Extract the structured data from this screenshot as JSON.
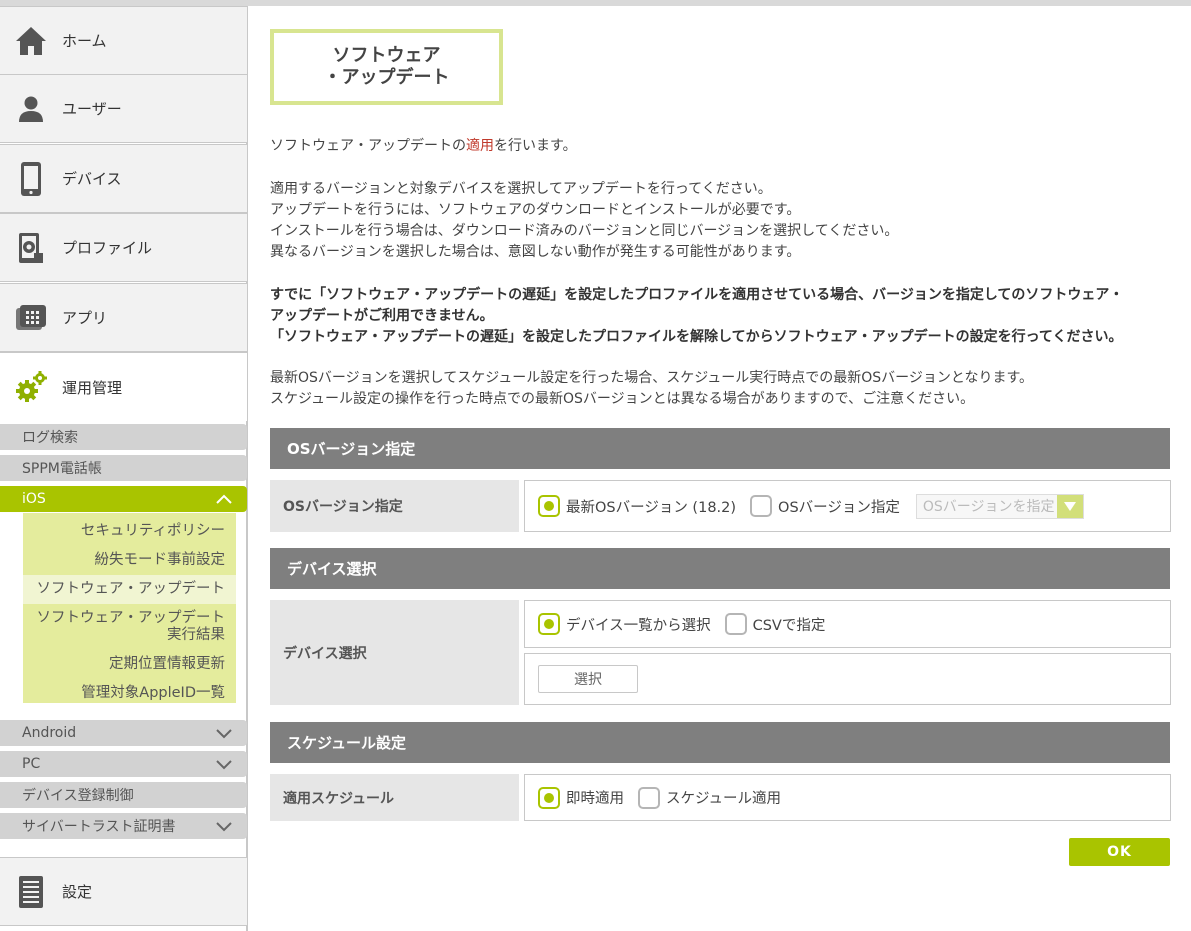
{
  "sidebar": {
    "nav": [
      {
        "label": "ホーム",
        "icon": "home-icon"
      },
      {
        "label": "ユーザー",
        "icon": "user-icon"
      },
      {
        "label": "デバイス",
        "icon": "smartphone-icon"
      },
      {
        "label": "プロファイル",
        "icon": "profile-gear-icon"
      },
      {
        "label": "アプリ",
        "icon": "app-icon"
      },
      {
        "label": "運用管理",
        "icon": "gears-icon"
      }
    ],
    "sub": {
      "log_search": "ログ検索",
      "sppm": "SPPM電話帳",
      "ios": "iOS",
      "android": "Android",
      "pc": "PC",
      "device_reg": "デバイス登録制御",
      "cybertrust": "サイバートラスト証明書"
    },
    "ios_links": {
      "security": "セキュリティポリシー",
      "lost_mode": "紛失モード事前設定",
      "software_update": "ソフトウェア・アップデート",
      "result_line1": "ソフトウェア・アップデート",
      "result_line2": "実行結果",
      "location": "定期位置情報更新",
      "appleid": "管理対象AppleID一覧"
    },
    "settings": "設定"
  },
  "main": {
    "title_line1": "ソフトウェア",
    "title_line2": "・アップデート",
    "intro_pre": "ソフトウェア・アップデートの",
    "intro_hl": "適用",
    "intro_post": "を行います。",
    "p2": [
      "適用するバージョンと対象デバイスを選択してアップデートを行ってください。",
      "アップデートを行うには、ソフトウェアのダウンロードとインストールが必要です。",
      "インストールを行う場合は、ダウンロード済みのバージョンと同じバージョンを選択してください。",
      "異なるバージョンを選択した場合は、意図しない動作が発生する可能性があります。"
    ],
    "warn": [
      "すでに「ソフトウェア・アップデートの遅延」を設定したプロファイルを適用させている場合、バージョンを指定してのソフトウェア・",
      "アップデートがご利用できません。",
      "「ソフトウェア・アップデートの遅延」を設定したプロファイルを解除してからソフトウェア・アップデートの設定を行ってください。"
    ],
    "p4": [
      "最新OSバージョンを選択してスケジュール設定を行った場合、スケジュール実行時点での最新OSバージョンとなります。",
      "スケジュール設定の操作を行った時点での最新OSバージョンとは異なる場合がありますので、ご注意ください。"
    ],
    "os_section": {
      "header": "OSバージョン指定",
      "label": "OSバージョン指定",
      "opt_latest": "最新OSバージョン (18.2)",
      "opt_specify": "OSバージョン指定",
      "select_placeholder": "OSバージョンを指定"
    },
    "device_section": {
      "header": "デバイス選択",
      "label": "デバイス選択",
      "opt_list": "デバイス一覧から選択",
      "opt_csv": "CSVで指定",
      "select_button": "選択"
    },
    "schedule_section": {
      "header": "スケジュール設定",
      "label": "適用スケジュール",
      "opt_now": "即時適用",
      "opt_schedule": "スケジュール適用"
    },
    "ok": "OK"
  },
  "colors": {
    "accent": "#a9c400",
    "ios_panel": "#e4ec9d",
    "section_header": "#7f7f7f",
    "highlight": "#c0392b"
  }
}
